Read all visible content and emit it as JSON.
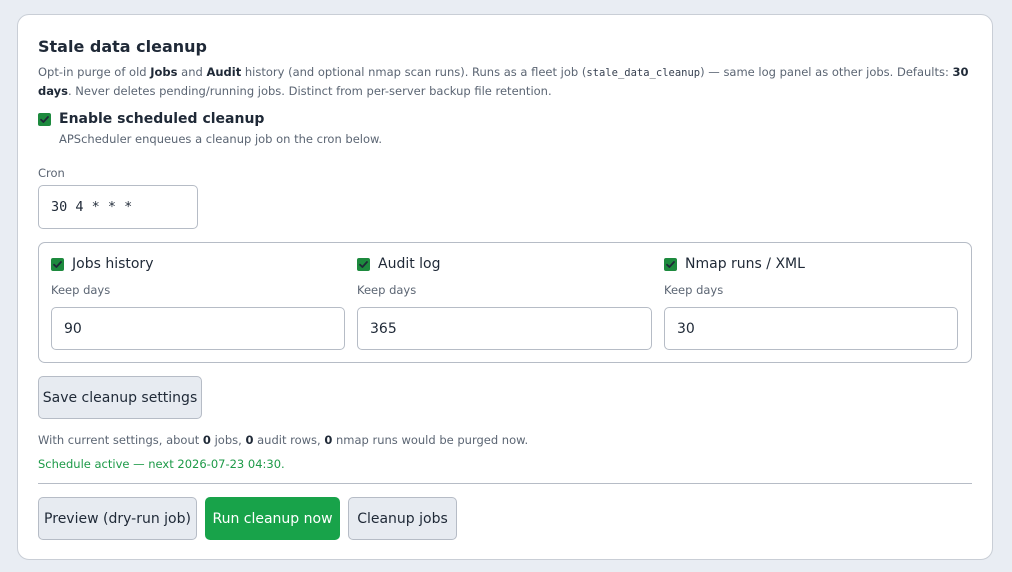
{
  "panel": {
    "title": "Stale data cleanup",
    "description": {
      "p1": "Opt-in purge of old ",
      "jobs_bold": "Jobs",
      "p2": " and ",
      "audit_bold": "Audit",
      "p3": " history (and optional nmap scan runs). Runs as a fleet job (",
      "job_code": "stale_data_cleanup",
      "p4": ") — same log panel as other jobs. Defaults: ",
      "defaults_bold": "30 days",
      "p5": ". Never deletes pending/running jobs. Distinct from per-server backup file retention."
    }
  },
  "schedule": {
    "enable_label": "Enable scheduled cleanup",
    "enabled": true,
    "hint": "APScheduler enqueues a cleanup job on the cron below.",
    "cron_label": "Cron",
    "cron_value": "30 4 * * *"
  },
  "targets": [
    {
      "label": "Jobs history",
      "checked": true,
      "keep_label": "Keep days",
      "keep_value": "90"
    },
    {
      "label": "Audit log",
      "checked": true,
      "keep_label": "Keep days",
      "keep_value": "365"
    },
    {
      "label": "Nmap runs / XML",
      "checked": true,
      "keep_label": "Keep days",
      "keep_value": "30"
    }
  ],
  "save_button": "Save cleanup settings",
  "summary": {
    "p1": "With current settings, about ",
    "jobs_count": "0",
    "p2": " jobs, ",
    "audit_count": "0",
    "p3": " audit rows, ",
    "nmap_count": "0",
    "p4": " nmap runs would be purged now."
  },
  "status_text": "Schedule active — next 2026-07-23 04:30.",
  "actions": {
    "preview": "Preview (dry-run job)",
    "run_now": "Run cleanup now",
    "cleanup_jobs": "Cleanup jobs"
  },
  "colors": {
    "accent_green": "#18a34a",
    "status_green": "#1d9a48",
    "checkbox_green": "#1d8a3e"
  }
}
